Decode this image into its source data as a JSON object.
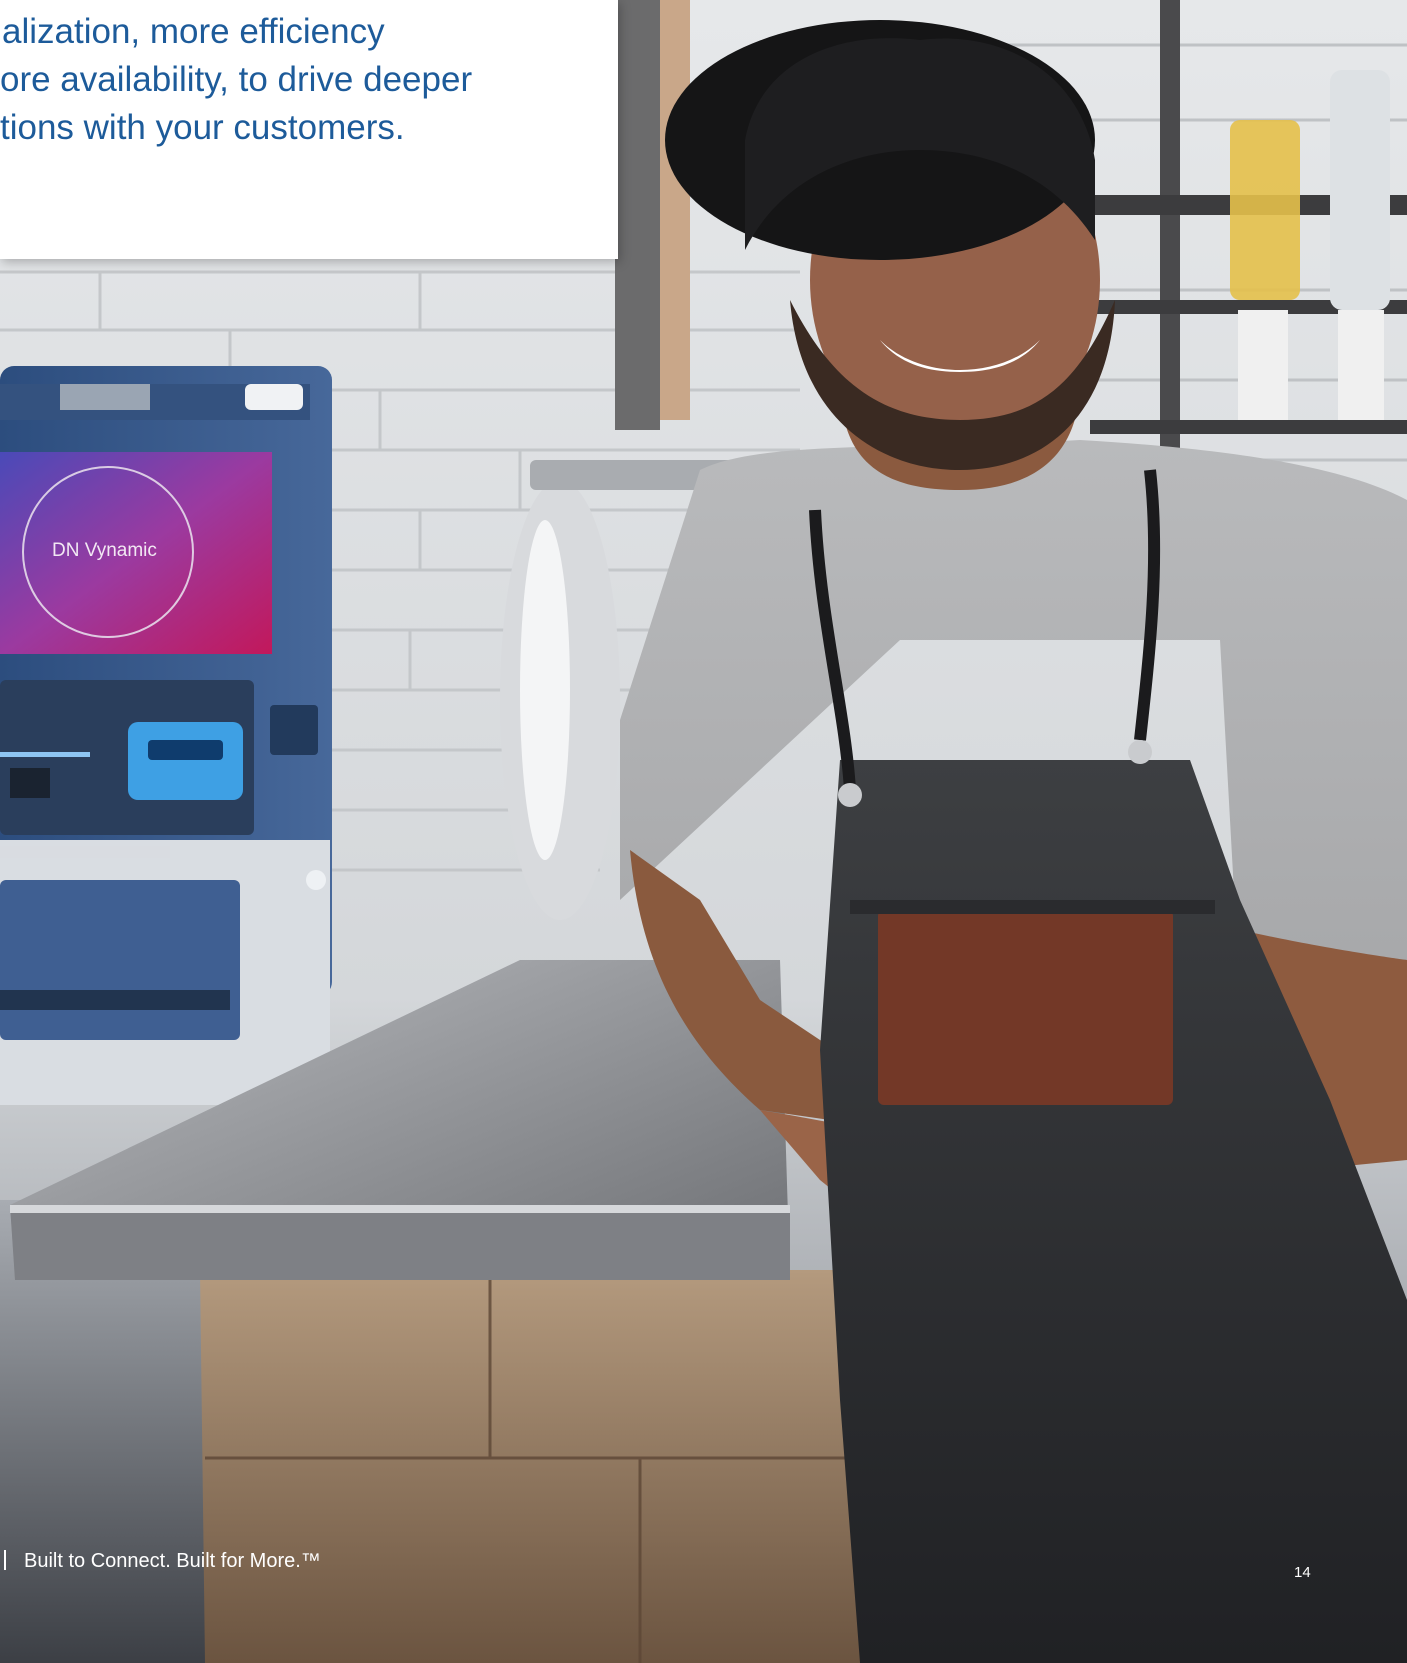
{
  "intro": {
    "lines": [
      "alization, more efficiency",
      "ore availability, to drive deeper",
      "tions with your customers."
    ]
  },
  "atm": {
    "screen_title": "DN Vynamic"
  },
  "footer": {
    "tagline": "Built to Connect. Built for More.™",
    "page_number": "14"
  }
}
